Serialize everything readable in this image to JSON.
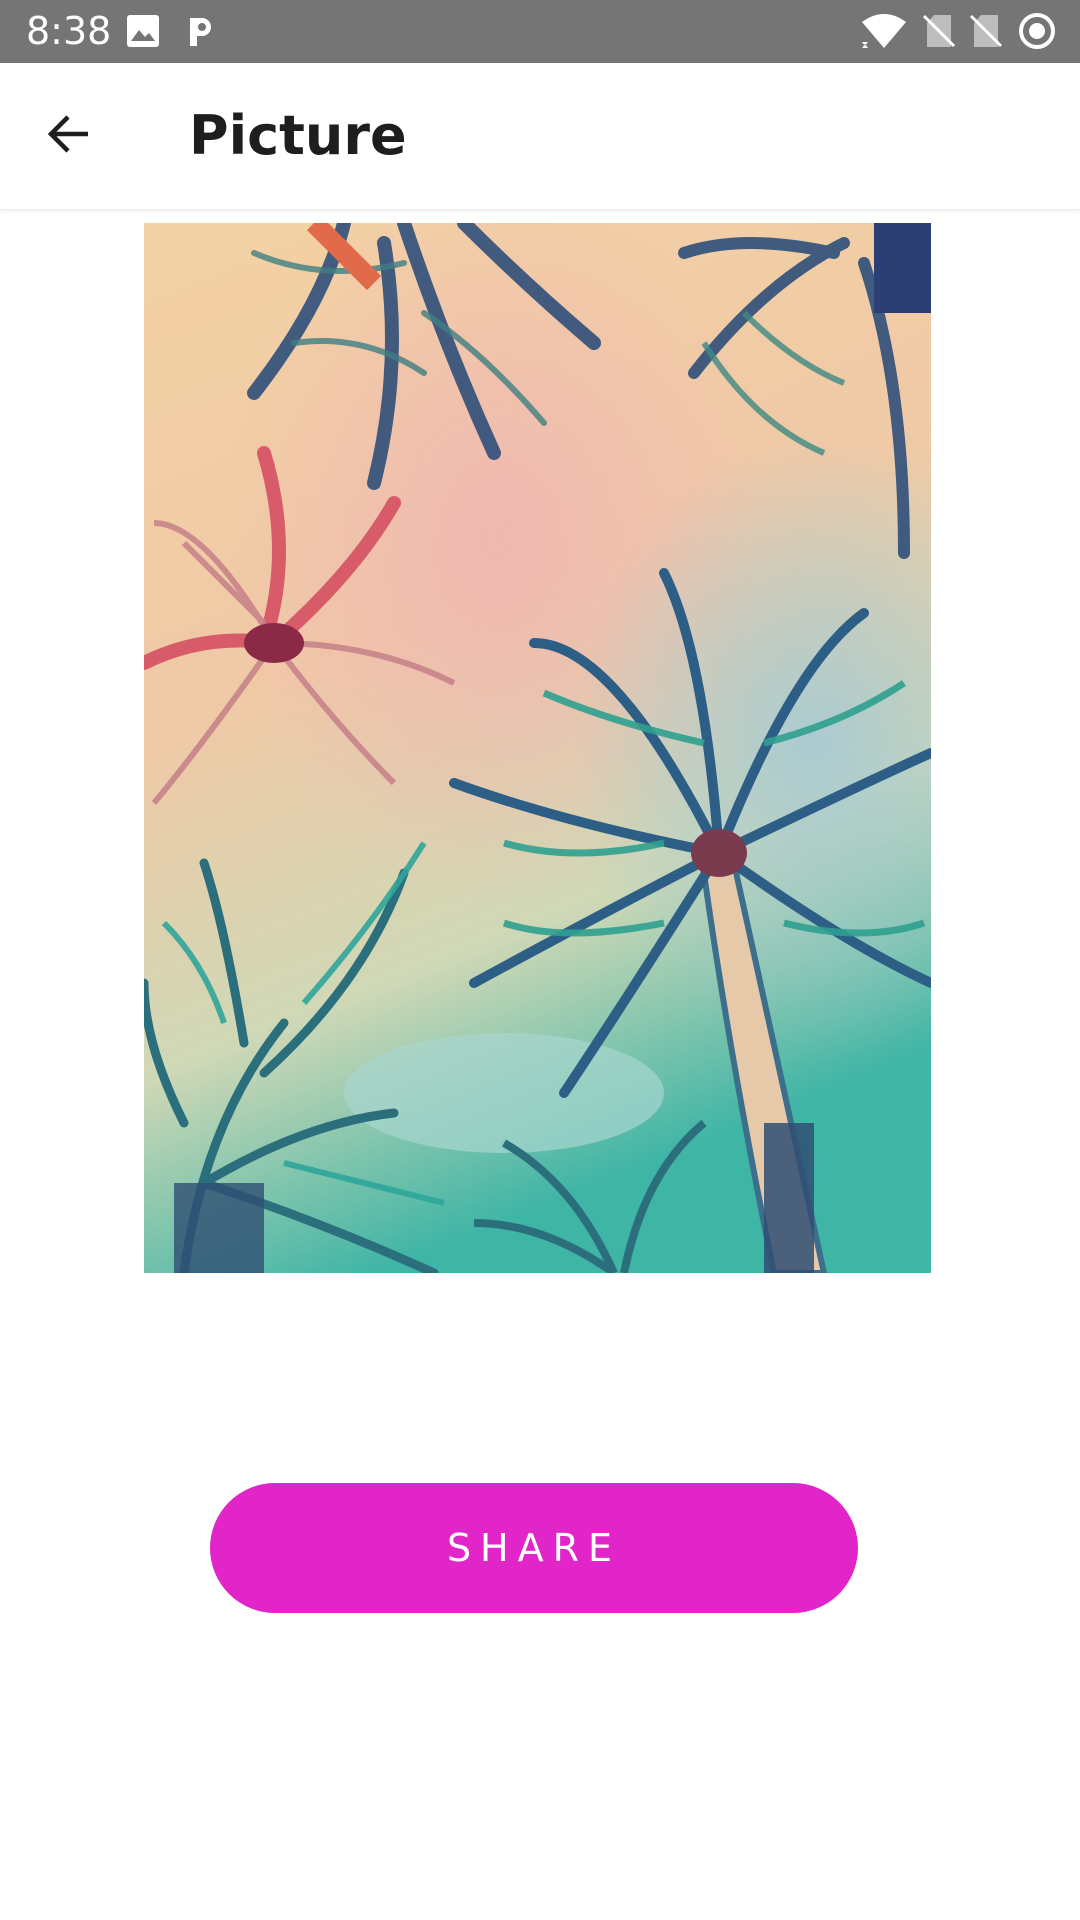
{
  "status_bar": {
    "time": "8:38",
    "left_icons": [
      "image-icon",
      "parking-p-icon"
    ],
    "right_icons": [
      "wifi-icon",
      "no-sim-icon",
      "no-sim-icon",
      "sync-circle-icon"
    ],
    "background": "#757575"
  },
  "app_bar": {
    "back_icon": "arrow-back-icon",
    "title": "Picture"
  },
  "picture": {
    "subject": "palm-trees-photo"
  },
  "share_button": {
    "label": "SHARE",
    "color": "#e125c8"
  }
}
